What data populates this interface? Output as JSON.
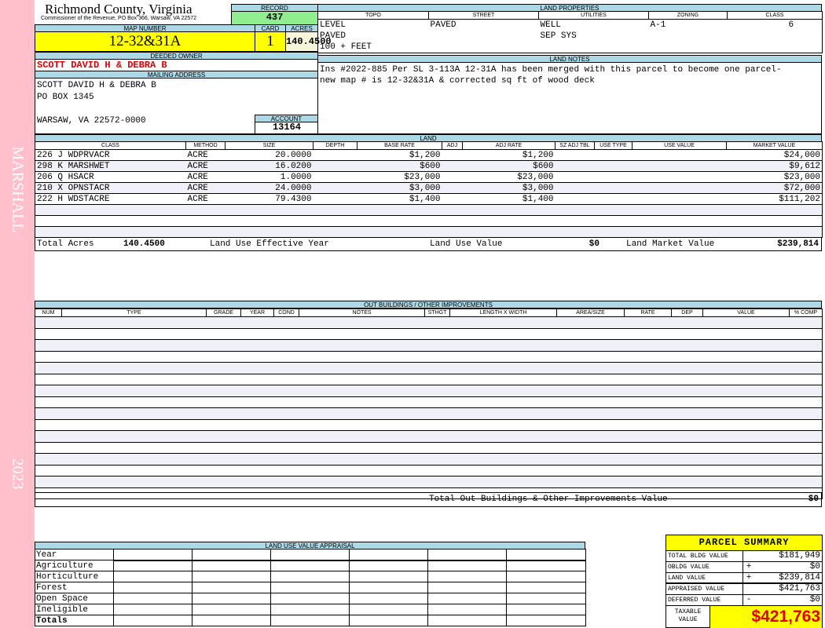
{
  "sidebar": {
    "district": "MARSHALL",
    "year": "2023"
  },
  "header": {
    "title": "Richmond County, Virginia",
    "subtitle": "Commissioner of the Revenue, PO Box 366, Warsaw, VA 22572"
  },
  "record": {
    "label": "RECORD",
    "value": "437"
  },
  "map": {
    "label": "MAP NUMBER",
    "value": "12-32&31A"
  },
  "card": {
    "label": "CARD",
    "value": "1"
  },
  "acres": {
    "label": "ACRES",
    "value": "140.4500"
  },
  "owner": {
    "label": "DEEDED OWNER",
    "value": "SCOTT DAVID H & DEBRA B"
  },
  "mailing": {
    "label": "MAILING ADDRESS",
    "lines": [
      "SCOTT DAVID H & DEBRA B",
      "PO BOX 1345",
      "",
      "WARSAW, VA 22572-0000"
    ]
  },
  "account": {
    "label": "ACCOUNT",
    "value": "13164"
  },
  "land_properties": {
    "label": "LAND PROPERTIES",
    "columns": [
      "TOPO",
      "STREET",
      "UTILITIES",
      "ZONING",
      "CLASS"
    ],
    "rows": [
      [
        "LEVEL",
        "PAVED",
        "WELL",
        "A-1",
        "6"
      ],
      [
        "PAVED",
        "",
        "SEP SYS",
        "",
        ""
      ],
      [
        "100 + FEET",
        "",
        "",
        "",
        ""
      ]
    ]
  },
  "land_notes": {
    "label": "LAND NOTES",
    "text": "Ins #2022-885 Per SL 3-113A 12-31A has been merged with this parcel to become one parcel-new map # is 12-32&31A & corrected sq ft of wood deck"
  },
  "land": {
    "label": "LAND",
    "columns": [
      "CLASS",
      "METHOD",
      "SIZE",
      "DEPTH",
      "BASE RATE",
      "ADJ",
      "ADJ RATE",
      "SZ ADJ TBL",
      "USE TYPE",
      "USE VALUE",
      "MARKET VALUE"
    ],
    "rows": [
      [
        "226 J WDPRVACR",
        "ACRE",
        "20.0000",
        "",
        "$1,200",
        "",
        "$1,200",
        "",
        "",
        "",
        "$24,000"
      ],
      [
        "298 K MARSHWET",
        "ACRE",
        "16.0200",
        "",
        "$600",
        "",
        "$600",
        "",
        "",
        "",
        "$9,612"
      ],
      [
        "206 Q HSACR",
        "ACRE",
        "1.0000",
        "",
        "$23,000",
        "",
        "$23,000",
        "",
        "",
        "",
        "$23,000"
      ],
      [
        "210 X OPNSTACR",
        "ACRE",
        "24.0000",
        "",
        "$3,000",
        "",
        "$3,000",
        "",
        "",
        "",
        "$72,000"
      ],
      [
        "222 H WDSTACRE",
        "ACRE",
        "79.4300",
        "",
        "$1,400",
        "",
        "$1,400",
        "",
        "",
        "",
        "$111,202"
      ],
      [
        "",
        "",
        "",
        "",
        "",
        "",
        "",
        "",
        "",
        "",
        ""
      ],
      [
        "",
        "",
        "",
        "",
        "",
        "",
        "",
        "",
        "",
        "",
        ""
      ],
      [
        "",
        "",
        "",
        "",
        "",
        "",
        "",
        "",
        "",
        "",
        ""
      ]
    ],
    "totals": {
      "acres_label": "Total Acres",
      "acres": "140.4500",
      "eff_year_label": "Land Use Effective Year",
      "eff_year": "",
      "use_value_label": "Land Use Value",
      "use_value": "$0",
      "market_label": "Land Market Value",
      "market": "$239,814"
    }
  },
  "outbuildings": {
    "label": "OUT BUILDINGS / OTHER IMPROVEMENTS",
    "columns": [
      "NUM",
      "TYPE",
      "GRADE",
      "YEAR",
      "COND",
      "NOTES",
      "STHGT",
      "LENGTH X WIDTH",
      "AREA/SIZE",
      "RATE",
      "DEP",
      "VALUE",
      "% COMP"
    ],
    "row_count": 16,
    "total_label": "Total Out Buildings & Other Improvements Value",
    "total": "$0"
  },
  "land_use_appraisal": {
    "label": "LAND USE VALUE APPRAISAL",
    "rows": [
      "Year",
      "Agriculture",
      "Horticulture",
      "Forest",
      "Open Space",
      "Ineligible",
      "Totals"
    ]
  },
  "summary": {
    "title": "PARCEL SUMMARY",
    "rows": [
      {
        "label": "TOTAL BLDG VALUE",
        "op": "",
        "value": "$181,949"
      },
      {
        "label": "OBLDG VALUE",
        "op": "+",
        "value": "$0"
      },
      {
        "label": "LAND VALUE",
        "op": "+",
        "value": "$239,814"
      },
      {
        "label": "APPRAISED VALUE",
        "op": "",
        "value": "$421,763"
      },
      {
        "label": "DEFERRED VALUE",
        "op": "-",
        "value": "$0"
      }
    ],
    "taxable_label": "TAXABLE VALUE",
    "taxable": "$421,763"
  },
  "colors": {
    "sidebar": "#ffc0cb",
    "label_bar": "#add8e6",
    "highlight": "#ffff00",
    "record": "#90ee90",
    "owner_text": "#e00000"
  }
}
